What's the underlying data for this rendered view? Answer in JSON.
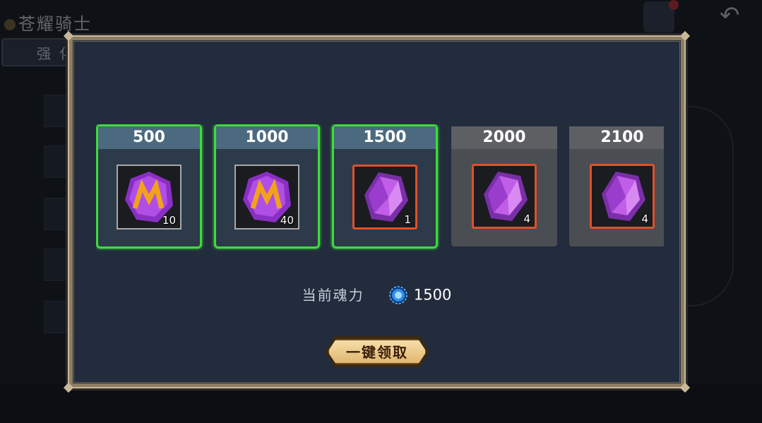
{
  "background": {
    "title": "苍耀骑士",
    "tab_label": "强化",
    "back_icon": "back-arrow-icon"
  },
  "modal": {
    "rewards": [
      {
        "threshold": "500",
        "count": "10",
        "item": "m-gem",
        "frame": "gray",
        "state": "claimable"
      },
      {
        "threshold": "1000",
        "count": "40",
        "item": "m-gem",
        "frame": "gray",
        "state": "claimable"
      },
      {
        "threshold": "1500",
        "count": "1",
        "item": "purple-crystal",
        "frame": "orange",
        "state": "claimable"
      },
      {
        "threshold": "2000",
        "count": "4",
        "item": "purple-crystal",
        "frame": "orange",
        "state": "locked"
      },
      {
        "threshold": "2100",
        "count": "4",
        "item": "purple-crystal",
        "frame": "orange",
        "state": "locked"
      }
    ],
    "current_power_label": "当前魂力",
    "current_power_value": "1500",
    "current_power_icon": "soul-orb-icon",
    "claim_all_label": "一键领取"
  },
  "colors": {
    "claimable_border": "#3ddc3a",
    "frame_orange": "#e0502a",
    "panel_bg": "#222c3d",
    "gold_trim": "#c9b99a"
  }
}
